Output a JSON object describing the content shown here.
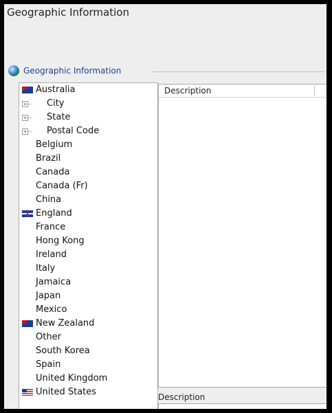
{
  "window": {
    "title": "Geographic Information"
  },
  "section": {
    "label": "Geographic Information",
    "icon": "globe-icon"
  },
  "tree": {
    "items": [
      {
        "label": "Australia",
        "flag": "australia"
      },
      {
        "label": "City",
        "child": true
      },
      {
        "label": "State",
        "child": true
      },
      {
        "label": "Postal Code",
        "child": true
      },
      {
        "label": "Belgium"
      },
      {
        "label": "Brazil"
      },
      {
        "label": "Canada"
      },
      {
        "label": "Canada (Fr)"
      },
      {
        "label": "China"
      },
      {
        "label": "England",
        "flag": "england"
      },
      {
        "label": "France"
      },
      {
        "label": "Hong Kong"
      },
      {
        "label": "Ireland"
      },
      {
        "label": "Italy"
      },
      {
        "label": "Jamaica"
      },
      {
        "label": "Japan"
      },
      {
        "label": "Mexico"
      },
      {
        "label": "New Zealand",
        "flag": "new-zealand"
      },
      {
        "label": "Other"
      },
      {
        "label": "South Korea"
      },
      {
        "label": "Spain"
      },
      {
        "label": "United Kingdom"
      },
      {
        "label": "United States",
        "flag": "united-states"
      }
    ]
  },
  "list": {
    "columns": [
      "Description"
    ]
  },
  "description": {
    "label": "Description",
    "value": ""
  }
}
